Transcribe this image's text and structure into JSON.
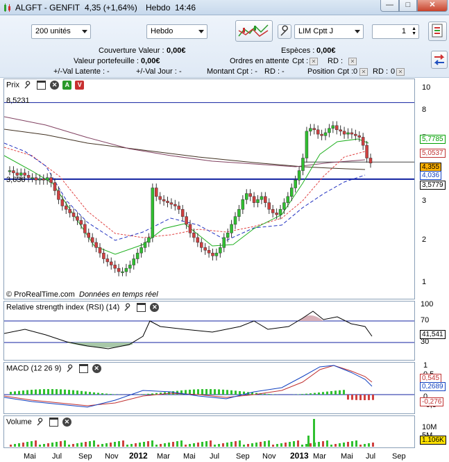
{
  "window": {
    "title_symbol": "ALGFT - GENFIT",
    "title_price": "4,35 (+1,64%)",
    "title_period": "Hebdo",
    "title_time": "14:46",
    "min_glyph": "—",
    "max_glyph": "□",
    "close_glyph": "✕"
  },
  "toolbar": {
    "units_select": "200 unités",
    "period_select": "Hebdo",
    "order_type_select": "LIM Cptt J",
    "quantity_value": "1",
    "couverture_label": "Couverture Valeur :",
    "couverture_value": "0,00€",
    "especes_label": "Espèces :",
    "especes_value": "0,00€",
    "portefeuille_label": "Valeur portefeuille :",
    "portefeuille_value": "0,00€",
    "ordres_label": "Ordres en attente",
    "ordres_cpt": "Cpt :",
    "ordres_rd": "RD :",
    "latente_label": "+/-Val Latente :",
    "latente_value": "-",
    "jour_label": "+/-Val Jour :",
    "jour_value": "-",
    "montant_label": "Montant",
    "montant_cpt": "Cpt : -",
    "montant_rd": "RD : -",
    "position_label": "Position",
    "position_cpt": "Cpt :",
    "position_cpt_value": "0",
    "position_rd": "RD :",
    "position_rd_value": "0"
  },
  "price_panel": {
    "title": "Prix",
    "label_a": "A",
    "label_v": "V",
    "high_label": "8,5231",
    "low_label": "3,636",
    "credit": "© ProRealTime.com",
    "credit_sub": "Données en temps réel",
    "axis_ticks": [
      "10",
      "8",
      "5",
      "4",
      "3",
      "2",
      "1"
    ],
    "tags": [
      {
        "text": "5,7785",
        "color": "#00a000",
        "bg": "#ffffff"
      },
      {
        "text": "5,0537",
        "color": "#c03030",
        "bg": "#ffffff"
      },
      {
        "text": "4,355",
        "color": "#000000",
        "bg": "#ffb000"
      },
      {
        "text": "4,036",
        "color": "#1040c0",
        "bg": "#ffffff"
      },
      {
        "text": "3,5779",
        "color": "#000000",
        "bg": "#ffffff"
      }
    ]
  },
  "rsi_panel": {
    "title": "Relative strength index (RSI) (14)",
    "axis_ticks": [
      "100",
      "70",
      "30"
    ],
    "value": "41,541"
  },
  "macd_panel": {
    "title": "MACD (12 26 9)",
    "axis_ticks": [
      "1",
      "0,5",
      "0",
      "-0,5"
    ],
    "tags": [
      {
        "text": "0,545",
        "color": "#c03030"
      },
      {
        "text": "0,2689",
        "color": "#1040c0"
      },
      {
        "text": "-0,276",
        "color": "#c03030"
      }
    ]
  },
  "volume_panel": {
    "title": "Volume",
    "axis_ticks": [
      "10M",
      "5M"
    ],
    "value": "1.106K"
  },
  "x_axis": {
    "labels": [
      "Mai",
      "Jul",
      "Sep",
      "Nov",
      "2012",
      "Mar",
      "Mai",
      "Jul",
      "Sep",
      "Nov",
      "2013",
      "Mar",
      "Mai",
      "Jul",
      "Sep"
    ]
  },
  "colors": {
    "up": "#30c030",
    "down": "#d04040",
    "sma_green": "#20b020",
    "sma_red": "#e04040",
    "sma_blue": "#2030c0",
    "sma_brown": "#403020",
    "sma_purple": "#804060"
  }
}
